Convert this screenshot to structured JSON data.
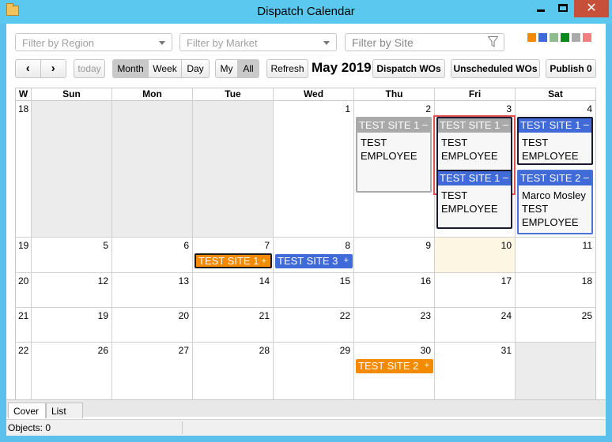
{
  "window": {
    "title": "Dispatch Calendar"
  },
  "filters": {
    "region_placeholder": "Filter by Region",
    "market_placeholder": "Filter by Market",
    "site_placeholder": "Filter by Site"
  },
  "swatch_colors": [
    "#f48a00",
    "#3f6ad8",
    "#8fbc8f",
    "#0a8a1a",
    "#aaaaaa",
    "#f08080"
  ],
  "toolbar": {
    "today": "today",
    "views": [
      "Month",
      "Week",
      "Day"
    ],
    "active_view": "Month",
    "scope": [
      "My",
      "All"
    ],
    "active_scope": "All",
    "refresh": "Refresh",
    "month_title": "May 2019",
    "dispatch": "Dispatch WOs",
    "unscheduled": "Unscheduled WOs",
    "publish": "Publish 0"
  },
  "calendar": {
    "week_header": "W",
    "days": [
      "Sun",
      "Mon",
      "Tue",
      "Wed",
      "Thu",
      "Fri",
      "Sat"
    ],
    "weeks": [
      {
        "wk": "18",
        "dates": [
          "",
          "",
          "",
          "1",
          "2",
          "3",
          "4"
        ]
      },
      {
        "wk": "19",
        "dates": [
          "5",
          "6",
          "7",
          "8",
          "9",
          "10",
          "11"
        ]
      },
      {
        "wk": "20",
        "dates": [
          "12",
          "13",
          "14",
          "15",
          "16",
          "17",
          "18"
        ]
      },
      {
        "wk": "21",
        "dates": [
          "19",
          "20",
          "21",
          "22",
          "23",
          "24",
          "25"
        ]
      },
      {
        "wk": "22",
        "dates": [
          "26",
          "27",
          "28",
          "29",
          "30",
          "31",
          ""
        ]
      }
    ]
  },
  "events": {
    "thu2": {
      "site": "TEST SITE 1",
      "toggle": "–",
      "lines": [
        "TEST",
        "EMPLOYEE"
      ]
    },
    "fri3a": {
      "site": "TEST SITE 1",
      "toggle": "–",
      "lines": [
        "TEST",
        "EMPLOYEE"
      ]
    },
    "fri3b": {
      "site": "TEST SITE 1",
      "toggle": "–",
      "lines": [
        "TEST",
        "EMPLOYEE"
      ]
    },
    "sat4a": {
      "site": "TEST SITE 1",
      "toggle": "–",
      "lines": [
        "TEST",
        "EMPLOYEE"
      ]
    },
    "sat4b": {
      "site": "TEST SITE 2",
      "toggle": "–",
      "lines": [
        "Marco Mosley",
        "TEST",
        "EMPLOYEE"
      ]
    },
    "tue7": {
      "site": "TEST SITE 1",
      "toggle": "+"
    },
    "wed8": {
      "site": "TEST SITE 3",
      "toggle": "+"
    },
    "thu30": {
      "site": "TEST SITE 2",
      "toggle": "+"
    }
  },
  "tabs": [
    "Cover",
    "List"
  ],
  "status": {
    "objects": "Objects: 0"
  }
}
